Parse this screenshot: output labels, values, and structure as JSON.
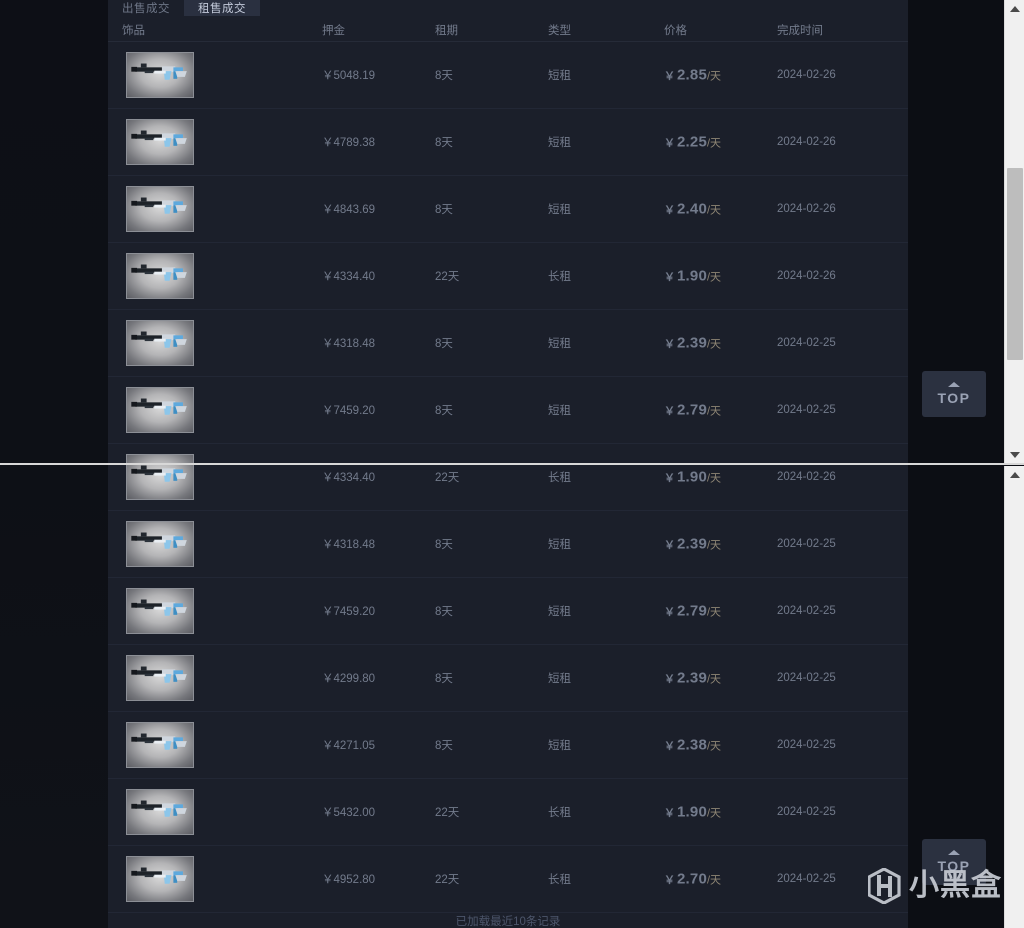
{
  "tabs": [
    {
      "label": "出售成交",
      "active": false
    },
    {
      "label": "租售成交",
      "active": true
    }
  ],
  "columns": {
    "item": "饰品",
    "deposit": "押金",
    "term": "租期",
    "type": "类型",
    "price": "价格",
    "time": "完成时间"
  },
  "currency_symbol": "￥",
  "price_unit": "/天",
  "rows": [
    {
      "deposit": "￥5048.19",
      "term": "8天",
      "type": "短租",
      "price": "2.85",
      "time": "2024-02-26"
    },
    {
      "deposit": "￥4789.38",
      "term": "8天",
      "type": "短租",
      "price": "2.25",
      "time": "2024-02-26"
    },
    {
      "deposit": "￥4843.69",
      "term": "8天",
      "type": "短租",
      "price": "2.40",
      "time": "2024-02-26"
    },
    {
      "deposit": "￥4334.40",
      "term": "22天",
      "type": "长租",
      "price": "1.90",
      "time": "2024-02-26"
    },
    {
      "deposit": "￥4318.48",
      "term": "8天",
      "type": "短租",
      "price": "2.39",
      "time": "2024-02-25"
    },
    {
      "deposit": "￥7459.20",
      "term": "8天",
      "type": "短租",
      "price": "2.79",
      "time": "2024-02-25"
    },
    {
      "deposit": "￥4334.40",
      "term": "22天",
      "type": "长租",
      "price": "1.90",
      "time": "2024-02-26"
    },
    {
      "deposit": "￥4318.48",
      "term": "8天",
      "type": "短租",
      "price": "2.39",
      "time": "2024-02-25"
    },
    {
      "deposit": "￥7459.20",
      "term": "8天",
      "type": "短租",
      "price": "2.79",
      "time": "2024-02-25"
    },
    {
      "deposit": "￥4299.80",
      "term": "8天",
      "type": "短租",
      "price": "2.39",
      "time": "2024-02-25"
    },
    {
      "deposit": "￥4271.05",
      "term": "8天",
      "type": "短租",
      "price": "2.38",
      "time": "2024-02-25"
    },
    {
      "deposit": "￥5432.00",
      "term": "22天",
      "type": "长租",
      "price": "1.90",
      "time": "2024-02-25"
    },
    {
      "deposit": "￥4952.80",
      "term": "22天",
      "type": "长租",
      "price": "2.70",
      "time": "2024-02-25"
    }
  ],
  "footer": {
    "note": "已加载最近10条记录"
  },
  "back_to_top": {
    "label": "TOP"
  },
  "watermark": {
    "text": "小黑盒"
  },
  "colors": {
    "panel_bg": "#1b1f2a",
    "page_bg": "#0b0d13",
    "price_accent": "#e8a020",
    "tab_active_bg": "#2a3040",
    "text_muted": "#737b8c",
    "row_divider": "#222735"
  }
}
